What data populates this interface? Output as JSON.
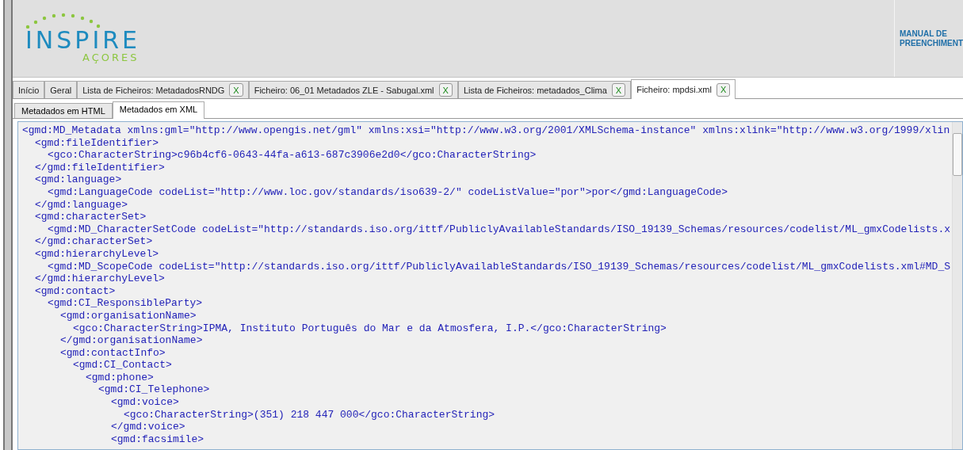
{
  "header": {
    "logo": {
      "title": "INSPIRE",
      "subtitle": "AÇORES"
    },
    "manual_button": {
      "line_1": "MANUAL DE",
      "line_2": "PREENCHIMENT"
    }
  },
  "tabs": [
    {
      "label": "Início",
      "closable": false,
      "selected": false
    },
    {
      "label": "Geral",
      "closable": false,
      "selected": false
    },
    {
      "label": "Lista de Ficheiros: MetadadosRNDG",
      "closable": true,
      "close_label": "X",
      "selected": false
    },
    {
      "label": "Ficheiro: 06_01 Metadados ZLE - Sabugal.xml",
      "closable": true,
      "close_label": "X",
      "selected": false
    },
    {
      "label": "Lista de Ficheiros: metadados_Clima",
      "closable": true,
      "close_label": "X",
      "selected": false
    },
    {
      "label": "Ficheiro: mpdsi.xml",
      "closable": true,
      "close_label": "X",
      "selected": true
    }
  ],
  "subtabs": [
    {
      "label": "Metadados em HTML",
      "selected": false
    },
    {
      "label": "Metadados em XML",
      "selected": true
    }
  ],
  "xml_lines": [
    {
      "text": "<gmd:MD_Metadata xmlns:gml=\"http://www.opengis.net/gml\" xmlns:xsi=\"http://www.w3.org/2001/XMLSchema-instance\" xmlns:xlink=\"http://www.w3.org/1999/xlin",
      "children": [
        {
          "text": "<gmd:fileIdentifier>",
          "children": [
            {
              "text": "<gco:CharacterString>c96b4cf6-0643-44fa-a613-687c3906e2d0</gco:CharacterString>"
            }
          ]
        },
        {
          "text": "</gmd:fileIdentifier>"
        },
        {
          "text": "<gmd:language>",
          "children": [
            {
              "text": "<gmd:LanguageCode codeList=\"http://www.loc.gov/standards/iso639-2/\" codeListValue=\"por\">por</gmd:LanguageCode>"
            }
          ]
        },
        {
          "text": "</gmd:language>"
        },
        {
          "text": "<gmd:characterSet>",
          "children": [
            {
              "text": "<gmd:MD_CharacterSetCode codeList=\"http://standards.iso.org/ittf/PubliclyAvailableStandards/ISO_19139_Schemas/resources/codelist/ML_gmxCodelists.x"
            }
          ]
        },
        {
          "text": "</gmd:characterSet>"
        },
        {
          "text": "<gmd:hierarchyLevel>",
          "children": [
            {
              "text": "<gmd:MD_ScopeCode codeList=\"http://standards.iso.org/ittf/PubliclyAvailableStandards/ISO_19139_Schemas/resources/codelist/ML_gmxCodelists.xml#MD_S"
            }
          ]
        },
        {
          "text": "</gmd:hierarchyLevel>"
        },
        {
          "text": "<gmd:contact>",
          "children": [
            {
              "text": "<gmd:CI_ResponsibleParty>",
              "children": [
                {
                  "text": "<gmd:organisationName>",
                  "children": [
                    {
                      "text": "<gco:CharacterString>IPMA, Instituto Português do Mar e da Atmosfera, I.P.</gco:CharacterString>"
                    }
                  ]
                },
                {
                  "text": "</gmd:organisationName>"
                },
                {
                  "text": "<gmd:contactInfo>",
                  "children": [
                    {
                      "text": "<gmd:CI_Contact>",
                      "children": [
                        {
                          "text": "<gmd:phone>",
                          "children": [
                            {
                              "text": "<gmd:CI_Telephone>",
                              "children": [
                                {
                                  "text": "<gmd:voice>",
                                  "children": [
                                    {
                                      "text": "<gco:CharacterString>(351) 218 447 000</gco:CharacterString>"
                                    }
                                  ]
                                },
                                {
                                  "text": "</gmd:voice>"
                                },
                                {
                                  "text": "<gmd:facsimile>"
                                }
                              ]
                            }
                          ]
                        }
                      ]
                    }
                  ]
                }
              ]
            }
          ]
        }
      ]
    }
  ]
}
